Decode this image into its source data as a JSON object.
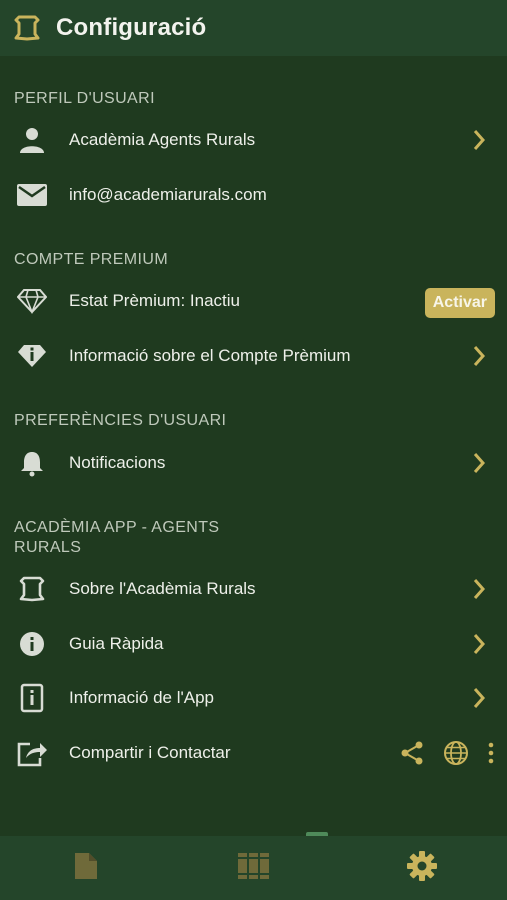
{
  "header": {
    "title": "Configuració",
    "logo_icon": "shield-icon"
  },
  "sections": {
    "profile": {
      "title": "PERFIL D'USUARI",
      "name": "Acadèmia Agents Rurals",
      "email": "info@academiarurals.com"
    },
    "premium": {
      "title": "COMPTE PREMIUM",
      "status": "Estat Prèmium: Inactiu",
      "activate_label": "Activar",
      "info": "Informació sobre el Compte Prèmium"
    },
    "preferences": {
      "title": "PREFERÈNCIES D'USUARI",
      "notifications": "Notificacions"
    },
    "app": {
      "title_line1": "ACADÈMIA APP - AGENTS",
      "title_line2": "RURALS",
      "about": "Sobre l'Acadèmia Rurals",
      "guide": "Guia Ràpida",
      "app_info": "Informació de l'App",
      "share": "Compartir i Contactar"
    }
  },
  "colors": {
    "background": "#1f3a1f",
    "bar": "#24452a",
    "accent": "#c9b45c",
    "icon": "#d8dcd4"
  },
  "bottom_nav": {
    "tabs": [
      {
        "icon": "document-icon",
        "active": false
      },
      {
        "icon": "library-icon",
        "active": false
      },
      {
        "icon": "settings-gear-icon",
        "active": true
      }
    ]
  }
}
